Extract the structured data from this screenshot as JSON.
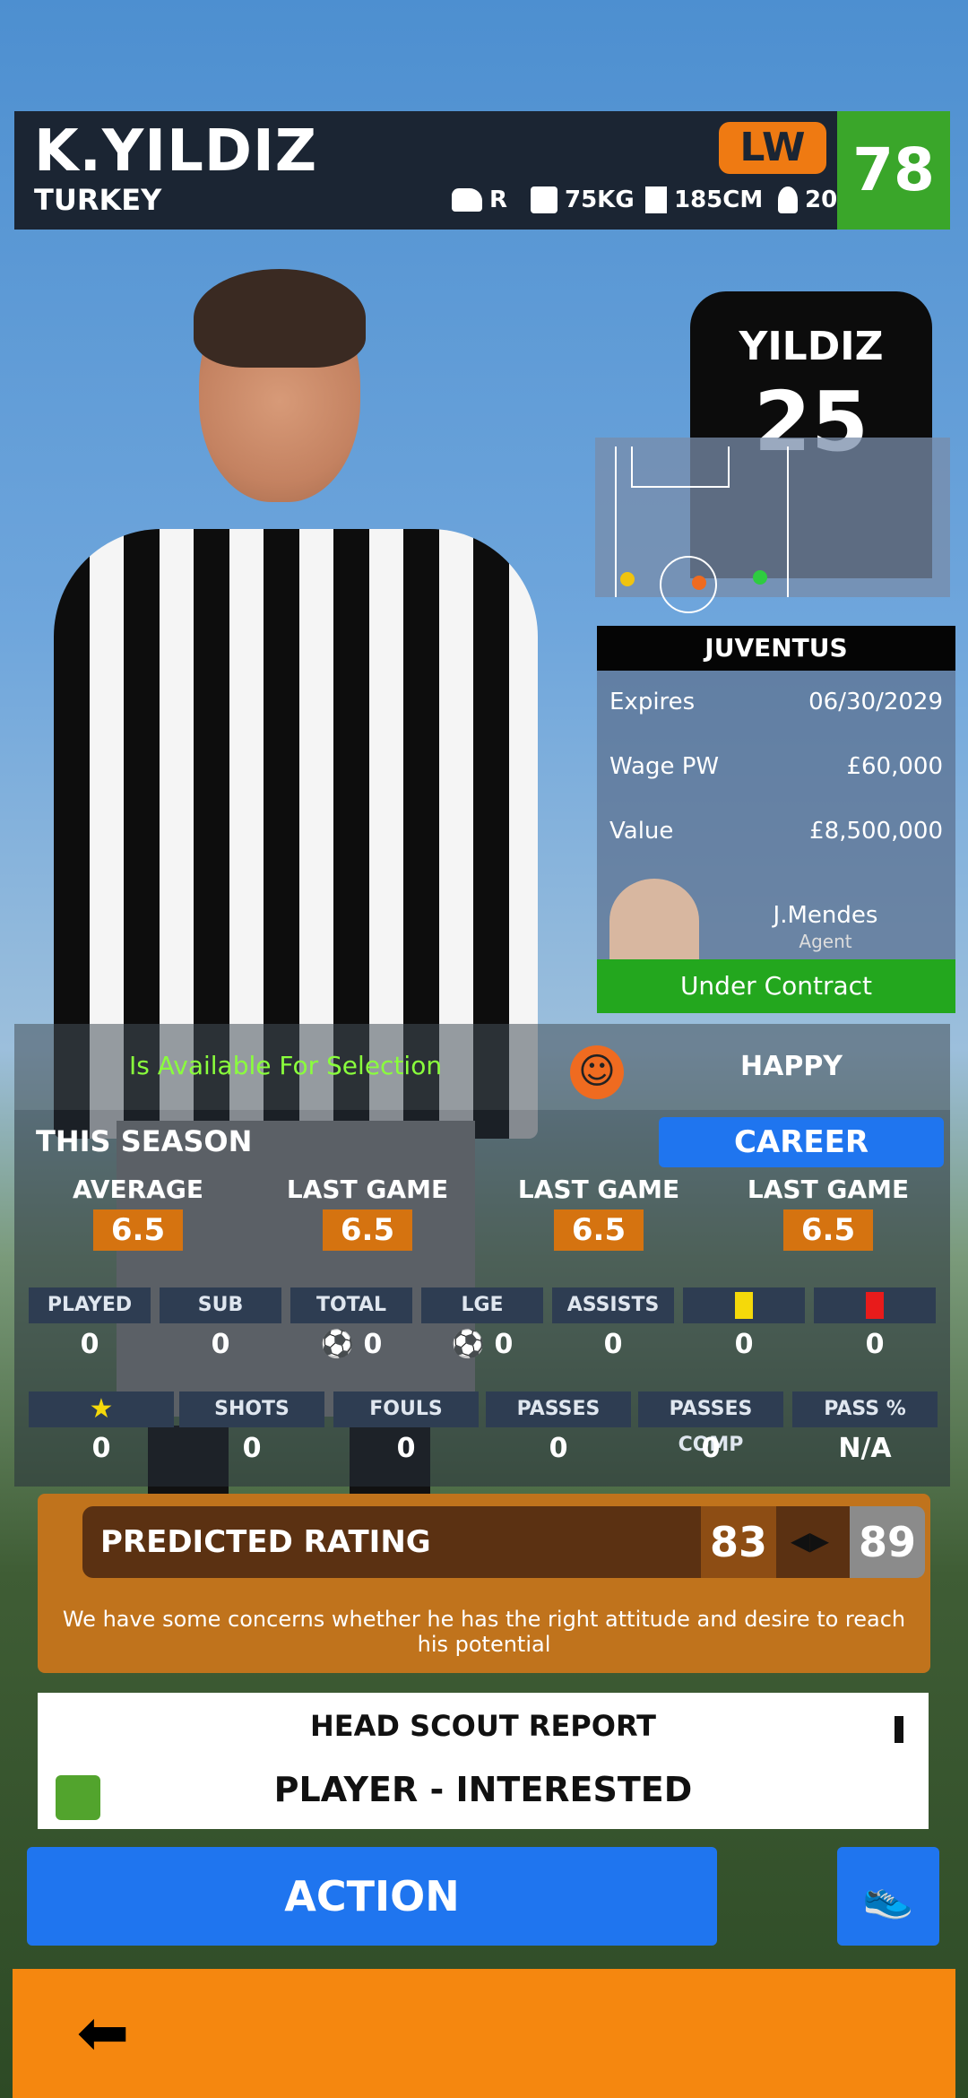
{
  "player": {
    "name": "K.YILDIZ",
    "nation": "TURKEY",
    "position": "LW",
    "rating": "78",
    "foot": "R",
    "weight": "75KG",
    "height": "185CM",
    "age": "20"
  },
  "jersey": {
    "name": "YILDIZ",
    "number": "25"
  },
  "pitch_dots": {
    "left": "#f1c40f",
    "center": "#ef6b20",
    "right": "#2ecc40"
  },
  "contract": {
    "club": "JUVENTUS",
    "rows": [
      {
        "label": "Expires",
        "value": "06/30/2029"
      },
      {
        "label": "Wage PW",
        "value": "£60,000"
      },
      {
        "label": "Value",
        "value": "£8,500,000"
      }
    ],
    "agent_name": "J.Mendes",
    "agent_role": "Agent",
    "status": "Under Contract"
  },
  "availability": {
    "text": "Is Available For Selection",
    "mood": "HAPPY"
  },
  "season": {
    "title": "THIS SEASON",
    "career_button": "CAREER",
    "ratings": [
      {
        "label": "AVERAGE",
        "value": "6.5"
      },
      {
        "label": "LAST GAME",
        "value": "6.5"
      },
      {
        "label": "LAST GAME",
        "value": "6.5"
      },
      {
        "label": "LAST GAME",
        "value": "6.5"
      }
    ],
    "stats_row1": [
      {
        "label": "PLAYED",
        "value": "0"
      },
      {
        "label": "SUB",
        "value": "0"
      },
      {
        "label": "TOTAL",
        "value": "0"
      },
      {
        "label": "LGE",
        "value": "0"
      },
      {
        "label": "ASSISTS",
        "value": "0"
      },
      {
        "label": "",
        "value": "0"
      },
      {
        "label": "",
        "value": "0"
      }
    ],
    "stats_row2": [
      {
        "label": "",
        "value": "0"
      },
      {
        "label": "SHOTS",
        "value": "0"
      },
      {
        "label": "FOULS",
        "value": "0"
      },
      {
        "label": "PASSES",
        "value": "0"
      },
      {
        "label": "PASSES COMP",
        "value": "0"
      },
      {
        "label": "PASS %",
        "value": "N/A"
      }
    ]
  },
  "predicted": {
    "title": "PREDICTED RATING",
    "low": "83",
    "high": "89",
    "text": "We have some concerns whether he has the right attitude and desire to reach his potential"
  },
  "scout": {
    "title": "HEAD SCOUT REPORT",
    "status": "PLAYER - INTERESTED"
  },
  "actions": {
    "action_label": "ACTION"
  },
  "icons": {
    "boot": "boot-icon",
    "weight": "scale-icon",
    "height": "ruler-icon",
    "age": "person-icon",
    "back": "back-arrow-icon",
    "thumb": "thumbs-up-icon",
    "star": "star-icon"
  },
  "colors": {
    "accent_blue": "#1f75ef",
    "accent_orange": "#f5870f",
    "rating_green": "#3aa62a"
  }
}
